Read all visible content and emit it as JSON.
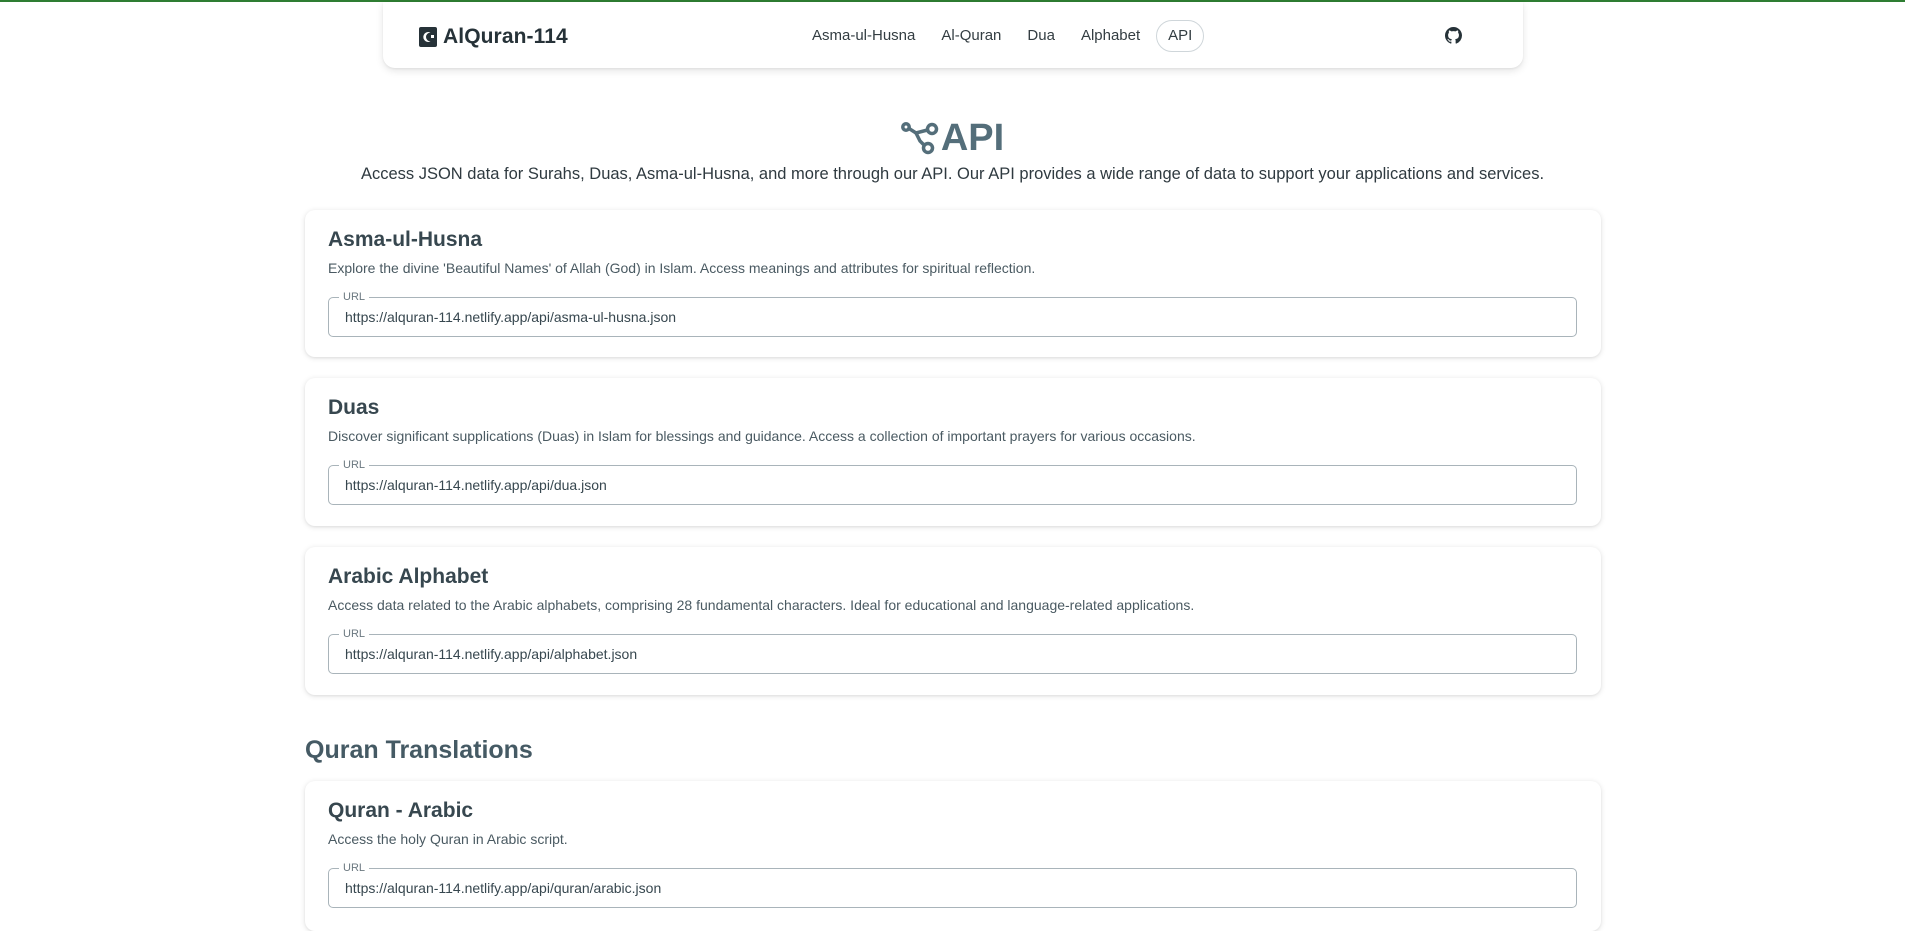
{
  "nav": {
    "brand": "AlQuran-114",
    "links": [
      {
        "label": "Asma-ul-Husna"
      },
      {
        "label": "Al-Quran"
      },
      {
        "label": "Dua"
      },
      {
        "label": "Alphabet"
      },
      {
        "label": "API"
      }
    ],
    "active": "API"
  },
  "header": {
    "title": "API",
    "subtitle": "Access JSON data for Surahs, Duas, Asma-ul-Husna, and more through our API. Our API provides a wide range of data to support your applications and services."
  },
  "cards": [
    {
      "title": "Asma-ul-Husna",
      "description": "Explore the divine 'Beautiful Names' of Allah (God) in Islam. Access meanings and attributes for spiritual reflection.",
      "url_label": "URL",
      "url": "https://alquran-114.netlify.app/api/asma-ul-husna.json"
    },
    {
      "title": "Duas",
      "description": "Discover significant supplications (Duas) in Islam for blessings and guidance. Access a collection of important prayers for various occasions.",
      "url_label": "URL",
      "url": "https://alquran-114.netlify.app/api/dua.json"
    },
    {
      "title": "Arabic Alphabet",
      "description": "Access data related to the Arabic alphabets, comprising 28 fundamental characters. Ideal for educational and language-related applications.",
      "url_label": "URL",
      "url": "https://alquran-114.netlify.app/api/alphabet.json"
    }
  ],
  "translations": {
    "heading": "Quran Translations",
    "cards": [
      {
        "title": "Quran - Arabic",
        "description": "Access the holy Quran in Arabic script.",
        "url_label": "URL",
        "url": "https://alquran-114.netlify.app/api/quran/arabic.json"
      }
    ]
  },
  "colors": {
    "accent_line": "#2e7d32",
    "title": "#546e7a"
  },
  "icons": {
    "brand": "quran-book-icon",
    "github": "github-icon",
    "api": "api-nodes-icon"
  }
}
